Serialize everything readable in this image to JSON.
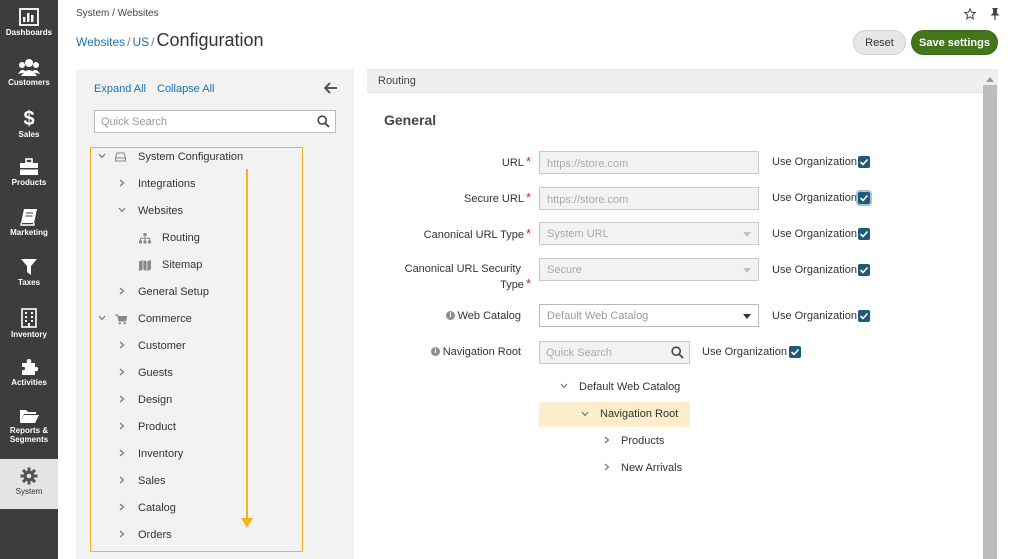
{
  "leftnav": {
    "items": [
      {
        "label": "Dashboards",
        "icon": "dashboard-icon"
      },
      {
        "label": "Customers",
        "icon": "customers-icon"
      },
      {
        "label": "Sales",
        "icon": "dollar-icon"
      },
      {
        "label": "Products",
        "icon": "briefcase-icon"
      },
      {
        "label": "Marketing",
        "icon": "book-icon"
      },
      {
        "label": "Taxes",
        "icon": "filter-icon"
      },
      {
        "label": "Inventory",
        "icon": "building-icon"
      },
      {
        "label": "Activities",
        "icon": "puzzle-icon"
      },
      {
        "label": "Reports &",
        "label2": "Segments",
        "icon": "folder-icon"
      },
      {
        "label": "System",
        "icon": "gear-icon"
      }
    ]
  },
  "header": {
    "breadcrumb_top": "System / Websites",
    "crumb1": "Websites",
    "crumb2": "US",
    "title": "Configuration",
    "reset_label": "Reset",
    "save_label": "Save settings"
  },
  "tree": {
    "expand_all": "Expand All",
    "collapse_all": "Collapse All",
    "search_placeholder": "Quick Search",
    "items": [
      {
        "label": "System Configuration"
      },
      {
        "label": "Integrations"
      },
      {
        "label": "Websites"
      },
      {
        "label": "Routing"
      },
      {
        "label": "Sitemap"
      },
      {
        "label": "General Setup"
      },
      {
        "label": "Commerce"
      },
      {
        "label": "Customer"
      },
      {
        "label": "Guests"
      },
      {
        "label": "Design"
      },
      {
        "label": "Product"
      },
      {
        "label": "Inventory"
      },
      {
        "label": "Sales"
      },
      {
        "label": "Catalog"
      },
      {
        "label": "Orders"
      }
    ]
  },
  "content": {
    "header": "Routing",
    "section_title": "General",
    "use_org_label": "Use Organization",
    "fields": {
      "url": {
        "label": "URL",
        "value": "https://store.com"
      },
      "secure_url": {
        "label": "Secure URL",
        "value": "https://store.com"
      },
      "canonical_type": {
        "label": "Canonical URL Type",
        "value": "System URL"
      },
      "canonical_security": {
        "label1": "Canonical URL Security",
        "label2": "Type",
        "value": "Secure"
      },
      "web_catalog": {
        "label": "Web Catalog",
        "value": "Default Web Catalog"
      },
      "nav_root": {
        "label": "Navigation Root",
        "placeholder": "Quick Search"
      }
    },
    "nav_tree": [
      {
        "label": "Default Web Catalog"
      },
      {
        "label": "Navigation Root"
      },
      {
        "label": "Products"
      },
      {
        "label": "New Arrivals"
      }
    ]
  },
  "colors": {
    "accent_green": "#43761c",
    "link_blue": "#1e6fb3",
    "highlight_yellow": "#f4b419",
    "checkbox_blue": "#1f5a7a"
  }
}
